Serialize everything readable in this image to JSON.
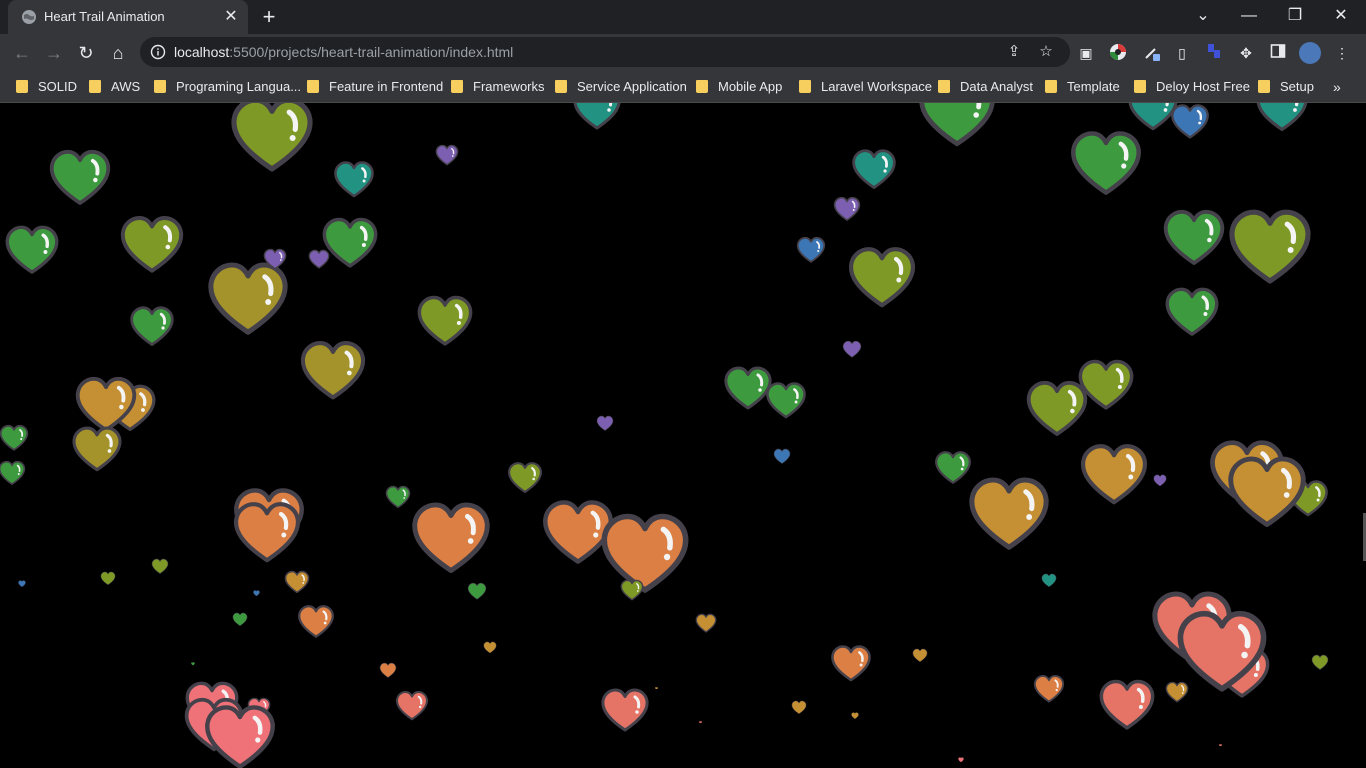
{
  "browser": {
    "tab_title": "Heart Trail Animation",
    "tab_close": "✕",
    "new_tab": "+",
    "url_host": "localhost",
    "url_rest": ":5500/projects/heart-trail-animation/index.html",
    "window_controls": {
      "chevron": "⌄",
      "minimize": "—",
      "restore": "❐",
      "close": "✕"
    },
    "nav_icons": {
      "back": "←",
      "forward": "→",
      "reload": "↻",
      "home": "⌂"
    }
  },
  "bookmarks": [
    "SOLID",
    "AWS",
    "Programing Langua...",
    "Feature in Frontend",
    "Frameworks",
    "Service Application",
    "Mobile App",
    "Laravel Workspace",
    "Data Analyst",
    "Template",
    "Deloy Host Free",
    "Setup"
  ],
  "bookmarks_overflow": "»",
  "heart_colors": {
    "green": "#3d9a3f",
    "olive": "#7e9926",
    "mustard": "#a3932a",
    "teal": "#229382",
    "blue": "#3c76b4",
    "purple": "#7c5fb0",
    "gold": "#c58f33",
    "orange": "#db7f44",
    "salmon": "#e57466",
    "pink": "#f07279",
    "outline": "#45414b"
  }
}
